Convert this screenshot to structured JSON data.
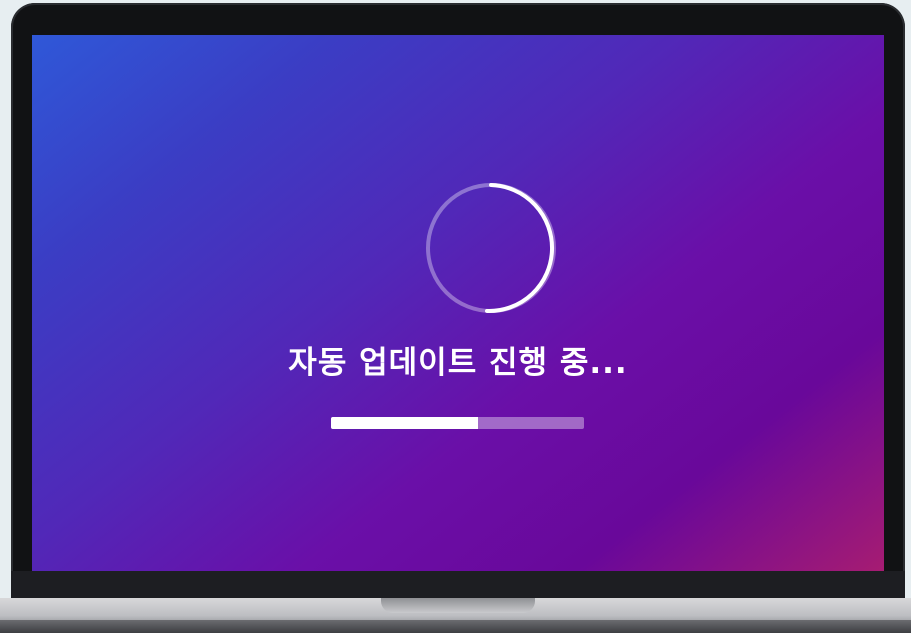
{
  "screen": {
    "status_text": "자동 업데이트 진행 중...",
    "progress": 0.58,
    "spinner_icon": "loading-spinner-icon"
  },
  "colors": {
    "text": "#ffffff",
    "progress_fill": "#ffffff",
    "progress_track": "rgba(255,255,255,0.38)"
  }
}
